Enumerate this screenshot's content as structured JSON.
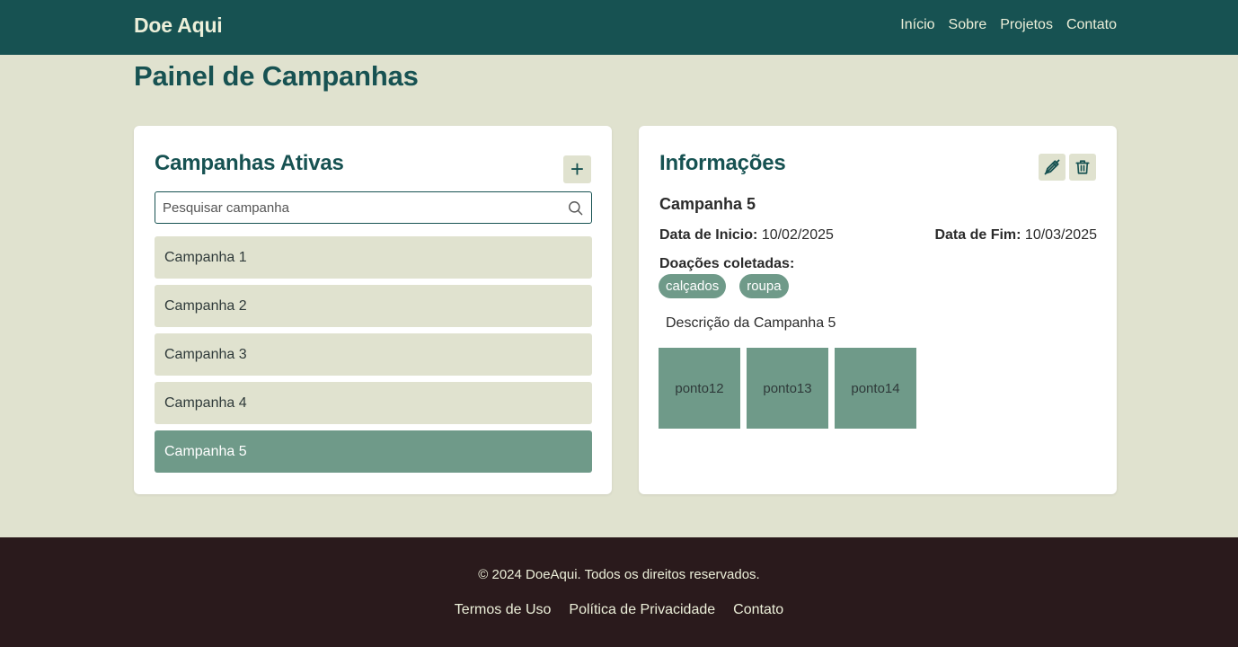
{
  "header": {
    "brand": "Doe Aqui",
    "nav": [
      "Início",
      "Sobre",
      "Projetos",
      "Contato"
    ]
  },
  "page": {
    "title": "Painel de Campanhas"
  },
  "campaigns_panel": {
    "title": "Campanhas Ativas",
    "add_icon": "plus-icon",
    "search_placeholder": "Pesquisar campanha",
    "search_value": "",
    "search_icon": "search-icon",
    "items": [
      "Campanha 1",
      "Campanha 2",
      "Campanha 3",
      "Campanha 4",
      "Campanha 5"
    ],
    "selected": "Campanha 5"
  },
  "info_panel": {
    "title": "Informações",
    "edit_icon": "pencil-off-icon",
    "delete_icon": "trash-icon",
    "campaign_name": "Campanha 5",
    "start_label": "Data de Inicio:",
    "start_value": "10/02/2025",
    "end_label": "Data de Fim:",
    "end_value": "10/03/2025",
    "donations_label": "Doações coletadas:",
    "donations": [
      "calçados",
      "roupa"
    ],
    "description": "Descrição da Campanha 5",
    "points": [
      "ponto12",
      "ponto13",
      "ponto14"
    ]
  },
  "footer": {
    "copyright": "© 2024 DoeAqui. Todos os direitos reservados.",
    "links": [
      "Termos de Uso",
      "Política de Privacidade",
      "Contato"
    ]
  },
  "colors": {
    "primary": "#175252",
    "background": "#e0e2cf",
    "accent": "#6f9a89",
    "footer": "#2a1a1c",
    "light_text": "#ecefd9"
  }
}
